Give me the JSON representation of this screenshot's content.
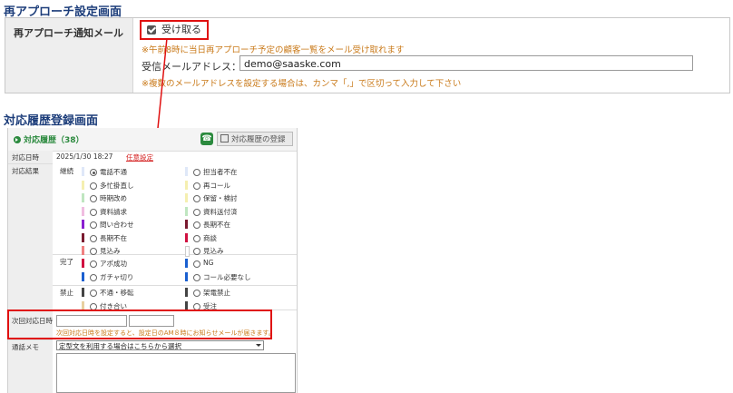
{
  "sec1": {
    "title": "再アプローチ設定画面",
    "label": "再アプローチ通知メール",
    "receive_label": "受け取る",
    "note1": "※午前8時に当日再アプローチ予定の顧客一覧をメール受け取れます",
    "addr_label": "受信メールアドレス：",
    "addr_value": "demo@saaske.com",
    "note2": "※複数のメールアドレスを設定する場合は、カンマ「,」で区切って入力して下さい"
  },
  "sec2": {
    "title": "対応履歴登録画面",
    "panel_title": "対応履歴（38）",
    "reg_button": "対応履歴の登録",
    "date_label": "対応日時",
    "date_value": "2025/1/30 18:27",
    "date_link": "任意設定",
    "result_label": "対応結果",
    "groups": {
      "cont": "継続",
      "done": "完了",
      "ban": "禁止"
    },
    "left_items": [
      "電話不通",
      "多忙掛直し",
      "時期改め",
      "資料請求",
      "問い合わせ",
      "長期不在",
      "見込み"
    ],
    "right_items": [
      "担当者不在",
      "再コール",
      "保留・検討",
      "資料送付済",
      "長期不在",
      "商談",
      "見込み"
    ],
    "done_left": [
      "アポ成功",
      "ガチャ切り"
    ],
    "done_right": [
      "NG",
      "コール必要なし"
    ],
    "ban_left": [
      "不通・移転",
      "付き合い"
    ],
    "ban_right": [
      "架電禁止",
      "受注"
    ],
    "next_label": "次回対応日時",
    "next_note": "次回対応日時を設定すると、設定日のAM８時にお知らせメールが届きます。",
    "memo_label": "通話メモ",
    "memo_select": "定型文を利用する場合はこちらから選択"
  },
  "colors": {
    "accent": "#e01010",
    "note": "#c97a1a",
    "green": "#2b8a3e"
  }
}
